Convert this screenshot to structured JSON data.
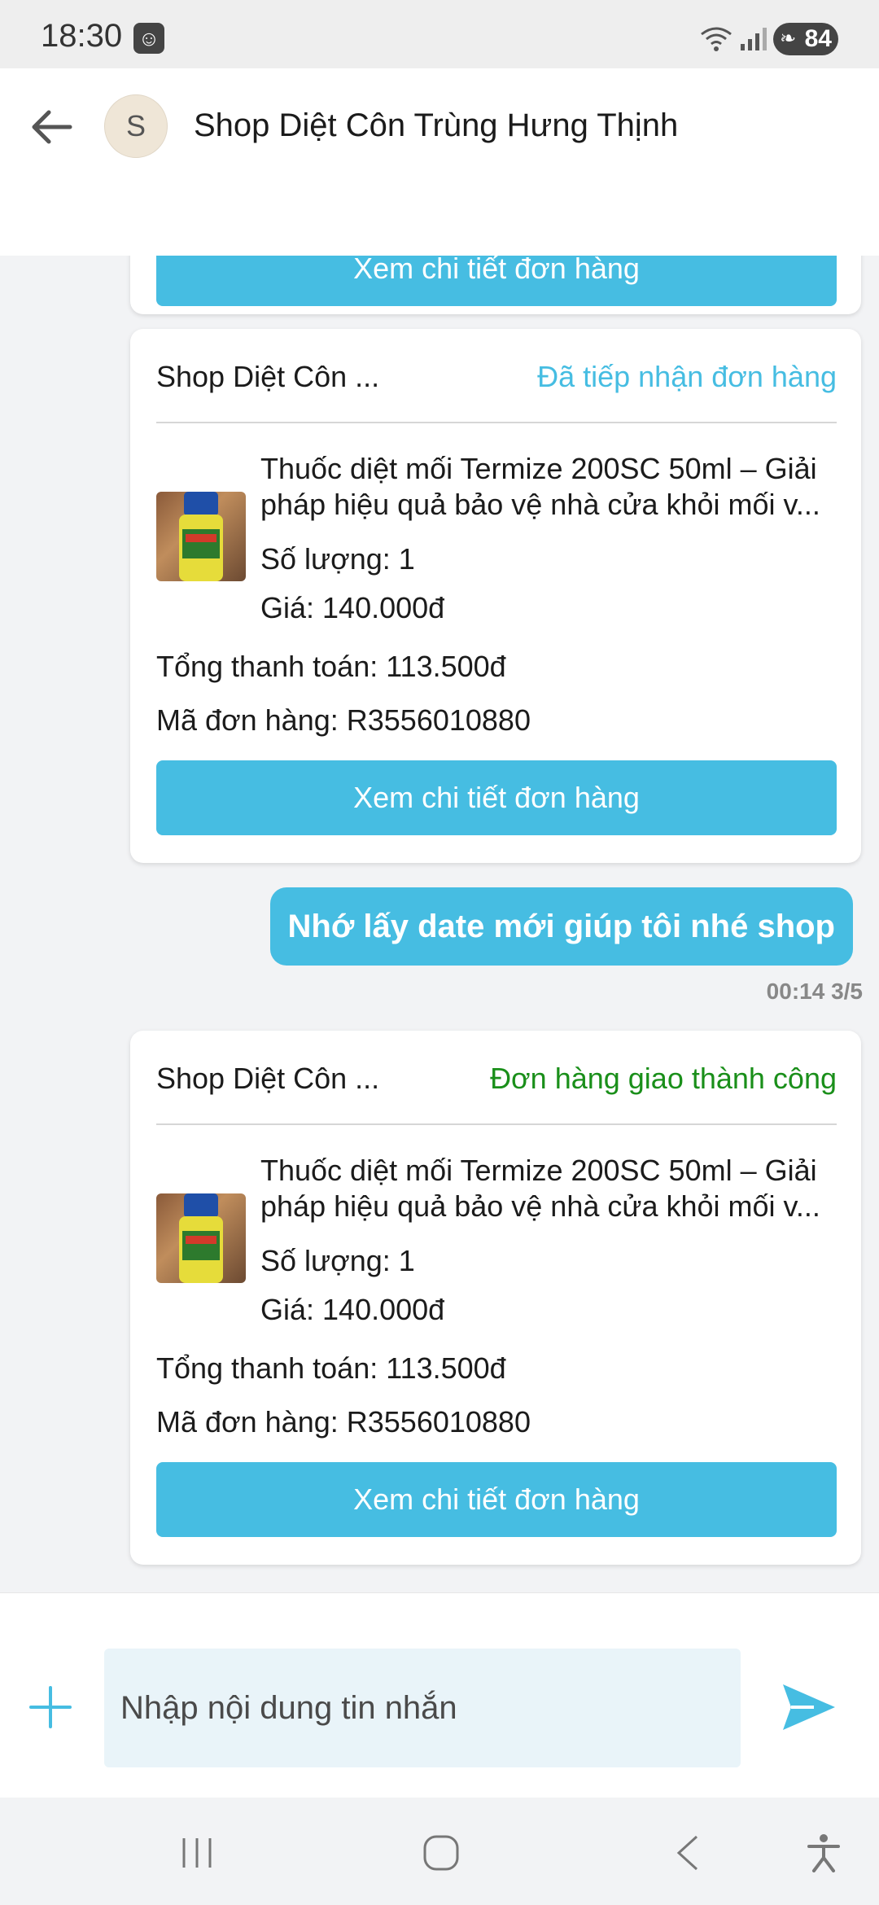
{
  "status_bar": {
    "time": "18:30",
    "battery": "84"
  },
  "header": {
    "avatar_letter": "S",
    "title": "Shop Diệt Côn Trùng Hưng Thịnh"
  },
  "top_card": {
    "button_label": "Xem chi tiết đơn hàng"
  },
  "orders": [
    {
      "shop": "Shop Diệt Côn ...",
      "status": "Đã tiếp nhận đơn hàng",
      "status_color": "#46bde2",
      "product_name": "Thuốc diệt mối Termize 200SC 50ml – Giải pháp hiệu quả bảo vệ nhà cửa khỏi mối v...",
      "quantity": "Số lượng: 1",
      "price": "Giá: 140.000đ",
      "total": "Tổng thanh toán: 113.500đ",
      "order_id": "Mã đơn hàng: R3556010880",
      "button_label": "Xem chi tiết đơn hàng"
    },
    {
      "shop": "Shop Diệt Côn ...",
      "status": "Đơn hàng giao thành công",
      "status_color": "#1a8f1a",
      "product_name": "Thuốc diệt mối Termize 200SC 50ml – Giải pháp hiệu quả bảo vệ nhà cửa khỏi mối v...",
      "quantity": "Số lượng: 1",
      "price": "Giá: 140.000đ",
      "total": "Tổng thanh toán: 113.500đ",
      "order_id": "Mã đơn hàng: R3556010880",
      "button_label": "Xem chi tiết đơn hàng"
    }
  ],
  "message": {
    "text": "Nhớ lấy date mới giúp tôi nhé shop",
    "time": "00:14 3/5"
  },
  "input": {
    "placeholder": "Nhập nội dung tin nhắn"
  },
  "colors": {
    "accent": "#46bde2",
    "success": "#1a8f1a"
  }
}
